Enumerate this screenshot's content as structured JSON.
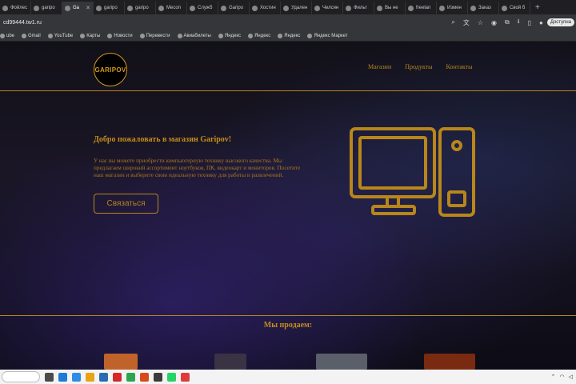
{
  "browser": {
    "tabs": [
      {
        "title": "Фойлес",
        "active": false
      },
      {
        "title": "garipo",
        "active": false
      },
      {
        "title": "Ga",
        "active": true
      },
      {
        "title": "garipo",
        "active": false
      },
      {
        "title": "garipo",
        "active": false
      },
      {
        "title": "Mecon",
        "active": false
      },
      {
        "title": "Служб",
        "active": false
      },
      {
        "title": "Garipo",
        "active": false
      },
      {
        "title": "Хостин",
        "active": false
      },
      {
        "title": "Удален",
        "active": false
      },
      {
        "title": "Челсян",
        "active": false
      },
      {
        "title": "Фильт",
        "active": false
      },
      {
        "title": "Вы не",
        "active": false
      },
      {
        "title": "freelan",
        "active": false
      },
      {
        "title": "Измен",
        "active": false
      },
      {
        "title": "Заказ",
        "active": false
      },
      {
        "title": "Свой б",
        "active": false
      }
    ],
    "new_tab": "+",
    "url": "cd99444.tw1.ru",
    "account_chip": "Доступна",
    "bookmarks": [
      "ube",
      "Gmail",
      "YouTube",
      "Карты",
      "Новости",
      "Перевести",
      "Авиабилеты",
      "Яндекс",
      "Яндекс",
      "Яндекс",
      "Яндекс Маркет"
    ]
  },
  "site": {
    "logo": "GARIPOV",
    "nav": [
      "Магазин",
      "Продукты",
      "Контакты"
    ],
    "hero_title": "Добро пожаловать в магазин Garipov!",
    "hero_text": "У нас вы можете приобрести компьютерную технику высокого качества. Мы предлагаем широкий ассортимент ноутбуков, ПК, видеокарт и мониторов. Посетите наш магазин и выберите свою идеальную технику для работы и развлечений.",
    "cta_label": "Связаться",
    "section_title": "Мы продаем:",
    "accent_color": "#b8861b"
  },
  "taskbar": {
    "icon_colors": [
      "#4a4a4a",
      "#1e7bd6",
      "#2f8be6",
      "#e8a317",
      "#2b6cb0",
      "#d62828",
      "#2ea44f",
      "#d84a1b",
      "#3c3c3c",
      "#25d366",
      "#e03b3b"
    ]
  }
}
